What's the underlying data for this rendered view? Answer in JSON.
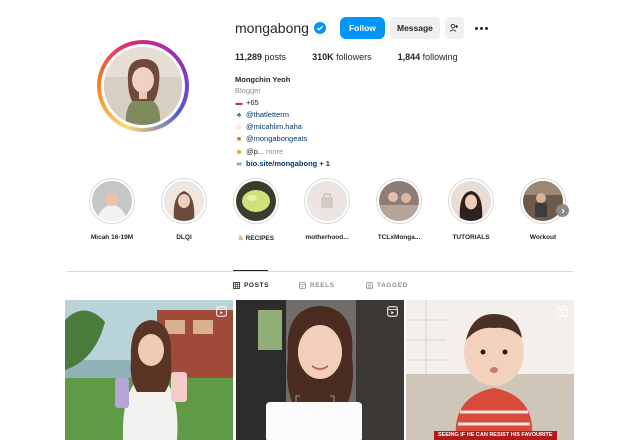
{
  "profile": {
    "username": "mongabong",
    "follow_label": "Follow",
    "message_label": "Message",
    "verified": true
  },
  "stats": [
    {
      "count": "11,289",
      "label": "posts"
    },
    {
      "count": "310K",
      "label": "followers"
    },
    {
      "count": "1,844",
      "label": "following"
    }
  ],
  "bio": {
    "name": "Mongchin Yeoh",
    "category": "Blogger",
    "line1": "+65",
    "line2": "@thatletterm",
    "line3": "@micahlim.haha",
    "line4": "@mongabongeats",
    "line5_prefix": "@p...",
    "line5_more": "more",
    "link": "bio.site/mongabong + 1"
  },
  "highlights": [
    {
      "label": "Micah 16-19M"
    },
    {
      "label": "DLQI"
    },
    {
      "label": "RECIPES"
    },
    {
      "label": "motherhood..."
    },
    {
      "label": "TCLxMonga..."
    },
    {
      "label": "TUTORIALS"
    },
    {
      "label": "Workout"
    }
  ],
  "tabs": {
    "posts": "POSTS",
    "reels": "REELS",
    "tagged": "TAGGED"
  },
  "posts": {
    "caption3": "SEEING IF HE CAN RESIST HIS FAVOURITE"
  },
  "colors": {
    "follow_blue": "#0095f6",
    "link_blue": "#00376b",
    "secondary_gray": "#8e8e8e",
    "caption_red": "#b11a1a"
  }
}
